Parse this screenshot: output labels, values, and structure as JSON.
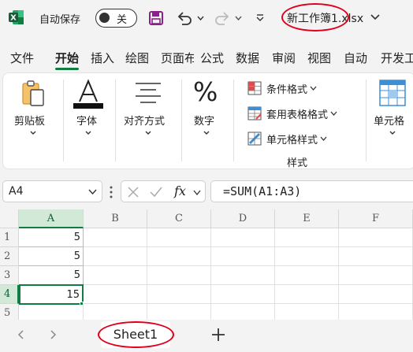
{
  "titlebar": {
    "autosave_label": "自动保存",
    "autosave_state": "关",
    "file_name": "新工作簿1.xlsx",
    "accent_color": "#107c41",
    "save_icon_color": "#8b1f8b"
  },
  "tabs": [
    "文件",
    "开始",
    "插入",
    "绘图",
    "页面布",
    "公式",
    "数据",
    "审阅",
    "视图",
    "自动",
    "开发工"
  ],
  "active_tab": "开始",
  "ribbon": {
    "clipboard": "剪贴板",
    "font": "字体",
    "align": "对齐方式",
    "number": "数字",
    "cond_format": "条件格式",
    "table_format": "套用表格格式",
    "cell_style": "单元格样式",
    "styles_group": "样式",
    "cells": "单元格"
  },
  "formula_bar": {
    "name_box": "A4",
    "fx_label": "fx",
    "formula": "=SUM(A1:A3)"
  },
  "grid": {
    "columns": [
      "A",
      "B",
      "C",
      "D",
      "E",
      "F"
    ],
    "rows": [
      "1",
      "2",
      "3",
      "4",
      "5"
    ],
    "cells": {
      "A1": "5",
      "A2": "5",
      "A3": "5",
      "A4": "15"
    },
    "active_cell": "A4"
  },
  "sheetbar": {
    "sheet_name": "Sheet1",
    "add_sheet": "+"
  },
  "annotations": {
    "circle_color": "#e0001b"
  }
}
